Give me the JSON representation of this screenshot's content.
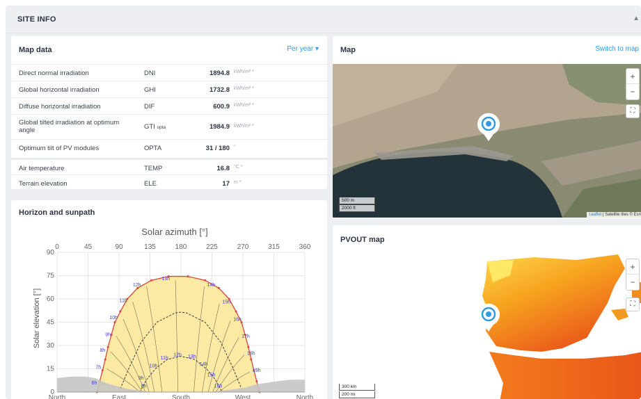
{
  "site_info": {
    "title": "SITE INFO",
    "collapse_icon": "chevron-up-icon"
  },
  "map_data": {
    "title": "Map data",
    "period_label": "Per year",
    "rows": [
      {
        "name": "Direct normal irradiation",
        "abbr": "DNI",
        "abbr_sub": "",
        "value": "1894.8",
        "unit": "kWh/m² *"
      },
      {
        "name": "Global horizontal irradiation",
        "abbr": "GHI",
        "abbr_sub": "",
        "value": "1732.8",
        "unit": "kWh/m² *"
      },
      {
        "name": "Diffuse horizontal irradiation",
        "abbr": "DIF",
        "abbr_sub": "",
        "value": "600.9",
        "unit": "kWh/m² *"
      },
      {
        "name": "Global tilted irradiation at optimum angle",
        "abbr": "GTI",
        "abbr_sub": "opta",
        "value": "1984.9",
        "unit": "kWh/m² *"
      },
      {
        "name": "Optimum tilt of PV modules",
        "abbr": "OPTA",
        "abbr_sub": "",
        "value": "31 / 180",
        "unit": "°"
      },
      {
        "name": "Air temperature",
        "abbr": "TEMP",
        "abbr_sub": "",
        "value": "16.8",
        "unit": "°C *"
      },
      {
        "name": "Terrain elevation",
        "abbr": "ELE",
        "abbr_sub": "",
        "value": "17",
        "unit": "m *"
      }
    ]
  },
  "map": {
    "title": "Map",
    "switch_label": "Switch to map",
    "zoom_in": "+",
    "zoom_out": "−",
    "fullscreen": "⛶",
    "scale_metric": "500 m",
    "scale_imperial": "2000 ft",
    "attribution_leaflet": "Leaflet",
    "attribution_rest": " | Satellite tiles © Esri",
    "marker_icon": "location-pin-icon",
    "colors": {
      "sea": "#23333a",
      "land": "#8a8a72",
      "urban": "#b9a894",
      "accent": "#2f9be0"
    }
  },
  "pvout": {
    "title": "PVOUT map",
    "zoom_in": "+",
    "zoom_out": "−",
    "fullscreen": "⛶",
    "scale_metric": "300 km",
    "scale_imperial": "200 mi",
    "marker_icon": "location-pin-icon",
    "colors": {
      "sea": "#ffffff",
      "low": "#ffd84a",
      "mid": "#f7a21f",
      "high": "#e9561a"
    }
  },
  "horizon": {
    "title": "Horizon and sunpath"
  },
  "chart_data": {
    "type": "line",
    "title": "Solar azimuth [°]",
    "xlabel": "",
    "ylabel": "Solar elevation [°]",
    "x_ticks": [
      "0",
      "45",
      "90",
      "135",
      "180",
      "225",
      "270",
      "315",
      "360"
    ],
    "x_ticks_bottom": [
      "North",
      "East",
      "South",
      "West",
      "North"
    ],
    "y_ticks": [
      "0",
      "15",
      "30",
      "45",
      "60",
      "75",
      "90"
    ],
    "xlim": [
      0,
      360
    ],
    "ylim": [
      0,
      90
    ],
    "grid": true,
    "horizon_profile": [
      [
        0,
        9
      ],
      [
        20,
        10
      ],
      [
        40,
        10
      ],
      [
        55,
        9
      ],
      [
        70,
        6
      ],
      [
        85,
        4
      ],
      [
        100,
        2
      ],
      [
        120,
        1
      ],
      [
        140,
        0
      ],
      [
        180,
        0
      ],
      [
        220,
        0
      ],
      [
        240,
        1
      ],
      [
        260,
        2
      ],
      [
        275,
        3
      ],
      [
        290,
        5
      ],
      [
        305,
        6
      ],
      [
        320,
        7
      ],
      [
        340,
        8
      ],
      [
        360,
        8
      ]
    ],
    "summer_sunpath": {
      "points": [
        [
          58,
          0
        ],
        [
          62,
          7
        ],
        [
          66,
          14
        ],
        [
          70,
          21
        ],
        [
          74,
          29
        ],
        [
          79,
          37
        ],
        [
          84,
          45
        ],
        [
          92,
          52
        ],
        [
          102,
          60
        ],
        [
          117,
          67
        ],
        [
          137,
          72
        ],
        [
          162,
          74.5
        ],
        [
          190,
          74.5
        ],
        [
          215,
          72
        ],
        [
          235,
          67
        ],
        [
          250,
          60
        ],
        [
          260,
          52
        ],
        [
          268,
          45
        ],
        [
          273,
          37
        ],
        [
          278,
          29
        ],
        [
          282,
          21
        ],
        [
          286,
          14
        ],
        [
          290,
          7
        ],
        [
          294,
          0
        ]
      ],
      "hour_labels": [
        {
          "label": "6h",
          "az": 66,
          "el": 5
        },
        {
          "label": "7h",
          "az": 72,
          "el": 15
        },
        {
          "label": "8h",
          "az": 78,
          "el": 26
        },
        {
          "label": "9h",
          "az": 86,
          "el": 36
        },
        {
          "label": "10h",
          "az": 96,
          "el": 47
        },
        {
          "label": "11h",
          "az": 110,
          "el": 58
        },
        {
          "label": "12h",
          "az": 130,
          "el": 68
        },
        {
          "label": "13h",
          "az": 172,
          "el": 72
        },
        {
          "label": "14h",
          "az": 214,
          "el": 68
        },
        {
          "label": "15h",
          "az": 236,
          "el": 57
        },
        {
          "label": "16h",
          "az": 252,
          "el": 46
        },
        {
          "label": "17h",
          "az": 264,
          "el": 35
        },
        {
          "label": "18h",
          "az": 272,
          "el": 24
        },
        {
          "label": "19h",
          "az": 280,
          "el": 13
        }
      ]
    },
    "mid_sunpath": {
      "points": [
        [
          90,
          0
        ],
        [
          105,
          16
        ],
        [
          122,
          32
        ],
        [
          145,
          45
        ],
        [
          172,
          51
        ],
        [
          180,
          51.5
        ],
        [
          188,
          51
        ],
        [
          215,
          45
        ],
        [
          238,
          32
        ],
        [
          255,
          16
        ],
        [
          270,
          0
        ]
      ]
    },
    "winter_sunpath": {
      "points": [
        [
          120,
          0
        ],
        [
          130,
          8
        ],
        [
          143,
          15
        ],
        [
          160,
          21
        ],
        [
          180,
          23
        ],
        [
          200,
          21
        ],
        [
          217,
          15
        ],
        [
          230,
          8
        ],
        [
          240,
          0
        ]
      ],
      "hour_labels": [
        {
          "label": "9h",
          "az": 122,
          "el": 8
        },
        {
          "label": "10h",
          "az": 140,
          "el": 16
        },
        {
          "label": "11h",
          "az": 156,
          "el": 21
        },
        {
          "label": "12h",
          "az": 175,
          "el": 23
        },
        {
          "label": "13h",
          "az": 196,
          "el": 22
        },
        {
          "label": "14h",
          "az": 213,
          "el": 17
        },
        {
          "label": "15h",
          "az": 224,
          "el": 10
        },
        {
          "label": "16h",
          "az": 234,
          "el": 3
        },
        {
          "label": "8h",
          "az": 126,
          "el": 3
        }
      ]
    },
    "colors": {
      "summer_curve": "#d8473f",
      "fill": "#fbe9a4",
      "analemma": "#3a3a3a",
      "hour_label": "#3b3fd1",
      "horizon": "#c5c5c5",
      "grid": "#e6e6e6"
    }
  }
}
